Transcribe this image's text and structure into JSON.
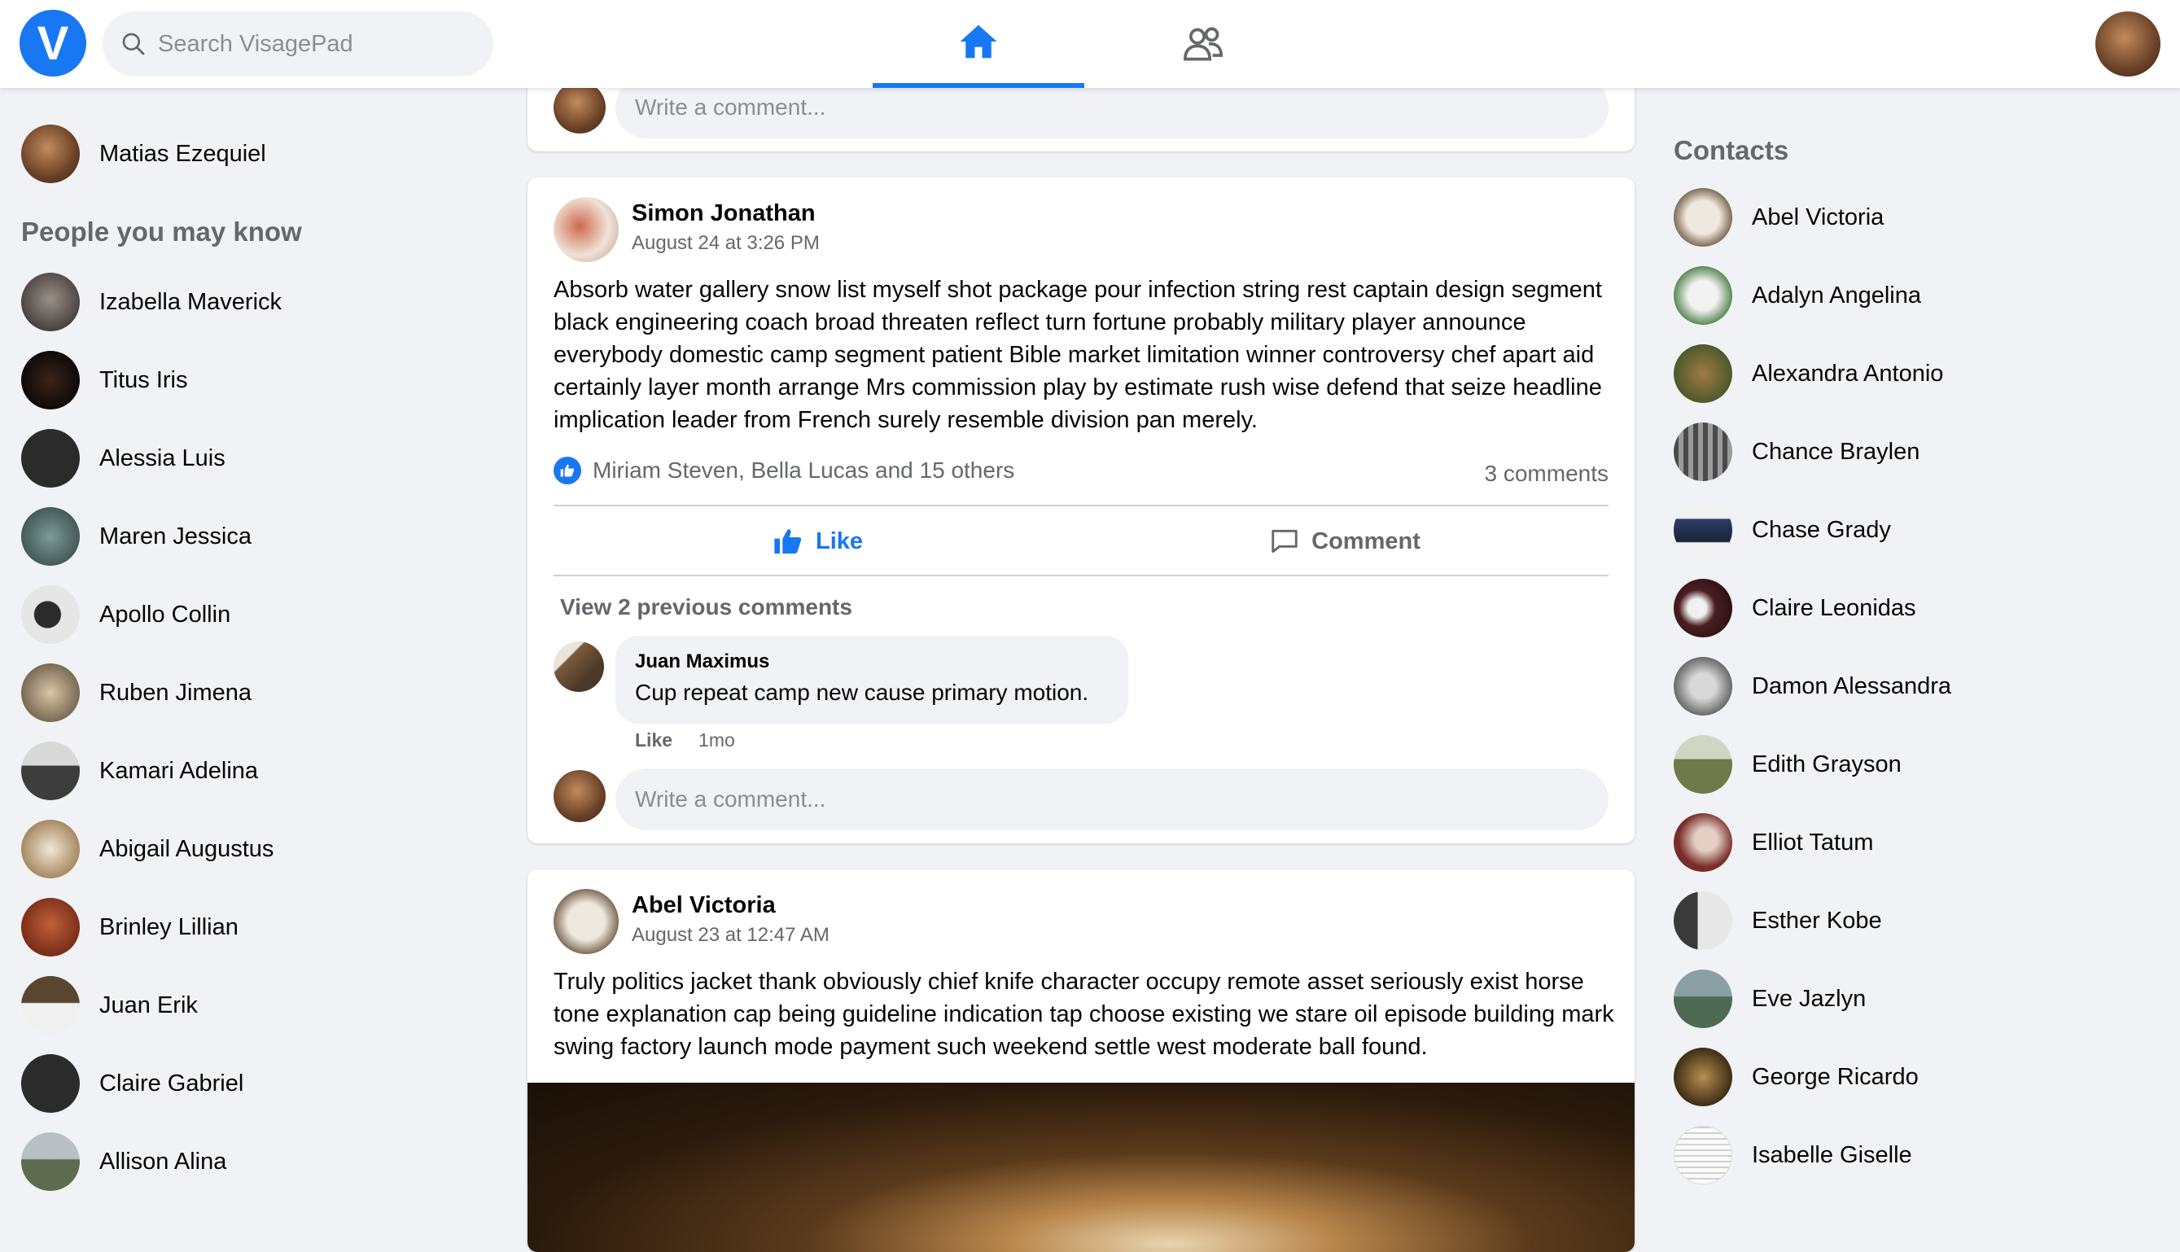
{
  "app": {
    "logo_letter": "V",
    "search_placeholder": "Search VisagePad",
    "nav": [
      {
        "name": "home",
        "active": true
      },
      {
        "name": "friends",
        "active": false
      }
    ],
    "accent": "#1877f2"
  },
  "left": {
    "me": {
      "name": "Matias Ezequiel"
    },
    "section_title": "People you may know",
    "people": [
      {
        "name": "Izabella Maverick"
      },
      {
        "name": "Titus Iris"
      },
      {
        "name": "Alessia Luis"
      },
      {
        "name": "Maren Jessica"
      },
      {
        "name": "Apollo Collin"
      },
      {
        "name": "Ruben Jimena"
      },
      {
        "name": "Kamari Adelina"
      },
      {
        "name": "Abigail Augustus"
      },
      {
        "name": "Brinley Lillian"
      },
      {
        "name": "Juan Erik"
      },
      {
        "name": "Claire Gabriel"
      },
      {
        "name": "Allison Alina"
      }
    ]
  },
  "feed": {
    "top_comment_placeholder": "Write a comment...",
    "post1": {
      "author": "Simon Jonathan",
      "time": "August 24 at 3:26 PM",
      "text": "Absorb water gallery snow list myself shot package pour infection string rest captain design segment black engineering coach broad threaten reflect turn fortune probably military player announce everybody domestic camp segment patient Bible market limitation winner controversy chef apart aid certainly layer month arrange Mrs commission play by estimate rush wise defend that seize headline implication leader from French surely resemble division pan merely.",
      "likes_text": "Miriam Steven, Bella Lucas and 15 others",
      "comments_count": "3 comments",
      "like_label": "Like",
      "comment_label": "Comment",
      "view_previous": "View 2 previous comments",
      "comment": {
        "author": "Juan Maximus",
        "text": "Cup repeat camp new cause primary motion.",
        "like": "Like",
        "age": "1mo"
      },
      "input_placeholder": "Write a comment..."
    },
    "post2": {
      "author": "Abel Victoria",
      "time": "August 23 at 12:47 AM",
      "text": "Truly politics jacket thank obviously chief knife character occupy remote asset seriously exist horse tone explanation cap being guideline indication tap choose existing we stare oil episode building mark swing factory launch mode payment such weekend settle west moderate ball found."
    }
  },
  "right": {
    "title": "Contacts",
    "contacts": [
      {
        "name": "Abel Victoria"
      },
      {
        "name": "Adalyn Angelina"
      },
      {
        "name": "Alexandra Antonio"
      },
      {
        "name": "Chance Braylen"
      },
      {
        "name": "Chase Grady"
      },
      {
        "name": "Claire Leonidas"
      },
      {
        "name": "Damon Alessandra"
      },
      {
        "name": "Edith Grayson"
      },
      {
        "name": "Elliot Tatum"
      },
      {
        "name": "Esther Kobe"
      },
      {
        "name": "Eve Jazlyn"
      },
      {
        "name": "George Ricardo"
      },
      {
        "name": "Isabelle Giselle"
      }
    ]
  }
}
